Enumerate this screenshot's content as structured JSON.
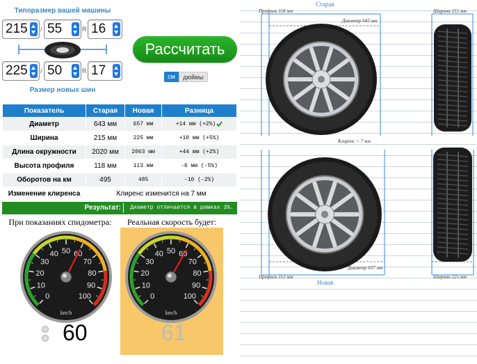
{
  "calc": {
    "title_current": "Типоразмер вашей машины",
    "title_new": "Размер новых шин",
    "current": {
      "width": "215",
      "profile": "55",
      "r_label": "R",
      "rim": "16"
    },
    "new": {
      "width": "225",
      "profile": "50",
      "r_label": "R",
      "rim": "17"
    },
    "slash": "/",
    "calc_button": "Рассчитать",
    "unit_cm": "см",
    "unit_inch": "дюймы"
  },
  "table": {
    "headers": [
      "Показатель",
      "Старая",
      "Новая",
      "Разница"
    ],
    "rows": [
      {
        "name": "Диаметр",
        "old": "643 мм",
        "new": "657 мм",
        "diff": "+14 мм (+2%)"
      },
      {
        "name": "Ширина",
        "old": "215 мм",
        "new": "225 мм",
        "diff": "+10 мм (+5%)"
      },
      {
        "name": "Длина окружности",
        "old": "2020 мм",
        "new": "2063 мм",
        "diff": "+44 мм (+2%)"
      },
      {
        "name": "Высота профиля",
        "old": "118 мм",
        "new": "113 мм",
        "diff": "-6 мм (-5%)"
      },
      {
        "name": "Оборотов на км",
        "old": "495",
        "new": "485",
        "diff": "-10 (-2%)"
      }
    ],
    "clearance_label": "Изменение клиренса",
    "clearance_value": "Клиренс изменится на 7 мм",
    "result_label": "Результат:",
    "result_value": "Диаметр отличается в рамках 3%."
  },
  "speed": {
    "label_shown": "При показаниях спидометра:",
    "label_real": "Реальная скорость будет:",
    "shown_value": "60",
    "real_value": "61",
    "unit": "km/h",
    "ticks": [
      "0",
      "10",
      "20",
      "30",
      "40",
      "50",
      "60",
      "70",
      "80",
      "90",
      "100"
    ]
  },
  "drawing": {
    "old_label": "Старая",
    "new_label": "Новая",
    "old_profile": "Профиль 118 мм",
    "old_width": "Ширина 215 мм",
    "old_diameter": "Диаметр 643 мм",
    "clearance": "Клиренс > 7 мм",
    "new_profile": "Профиль 113 мм",
    "new_width": "Ширина 225 мм",
    "new_diameter": "Диаметр 657 мм"
  },
  "colors": {
    "accent": "#1f7fcc",
    "button_green": "#1a9a1a",
    "result_green": "#228b22",
    "highlight": "#f8c76a"
  }
}
